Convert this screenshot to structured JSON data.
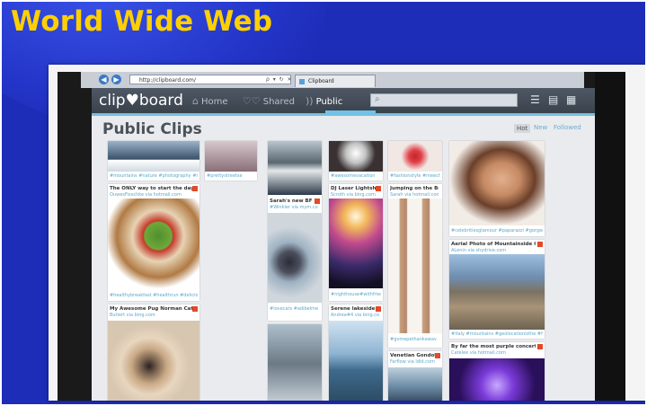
{
  "slide": {
    "title": "World Wide Web"
  },
  "browser": {
    "back_icon": "arrow-left-icon",
    "forward_icon": "arrow-right-icon",
    "address": "http://clipboard.com/",
    "address_icons": "ρ ▾ ↻ ✕",
    "tab_title": "Clipboard"
  },
  "app": {
    "logo": "clip♥board",
    "nav": {
      "home": "Home",
      "shared": "Shared",
      "public": "Public"
    },
    "search_placeholder": ""
  },
  "page": {
    "title": "Public Clips",
    "sort": {
      "hot": "Hot",
      "new": "New",
      "followed": "Followed"
    }
  },
  "cards": [
    {
      "tags": "#mountains #nature #photography #sailor"
    },
    {
      "tags": "#prettystreetse"
    },
    {
      "tags": "#awesomevacation"
    },
    {
      "tags": "#fashionstyle #meech"
    },
    {
      "title": "The ONLY way to start the day...",
      "source": "OuwesFixschke via hotmail.com",
      "tags": "#healthybreakfast #healthrun #delicious #eatforfood"
    },
    {
      "title": "Sarah's new BF",
      "source": "#Winkler via mym.com",
      "tags": "#lovecats #adibelme"
    },
    {
      "title": "DJ Laser Lightshow...",
      "source": "Scroth via bing.com",
      "tags": "#nighthouse#withfriends"
    },
    {
      "title": "Jumping on the Bed",
      "source": "Sarah via hotmail.com",
      "tags": "#gvmepethankawav"
    },
    {
      "tags": "#celebritiesglamour #paparazzi #gorgeous"
    },
    {
      "title": "Aerial Photo of Mountainside City - Italian...",
      "source": "ALenin via shydrive.com",
      "tags": "#italy #mountains #geolocationisthe #foto"
    },
    {
      "title": "My Awesome Pug Norman Catching a Treat!!",
      "source": "Butlert via bing.com"
    },
    {
      "title": "Serene lakeside vi...",
      "source": "Andrea#4 via bing.com"
    },
    {
      "title": "Venetian Gondolas",
      "source": "Farflow via ldid.com"
    },
    {
      "title": "By far the most purple concert I've ever be...",
      "source": "Catelee via hotmail.com"
    }
  ],
  "colors": {
    "accent": "#74c1e0",
    "slide_bg": "#1e2db8",
    "title_yellow": "#ffd000",
    "badge": "#e24a2a"
  }
}
